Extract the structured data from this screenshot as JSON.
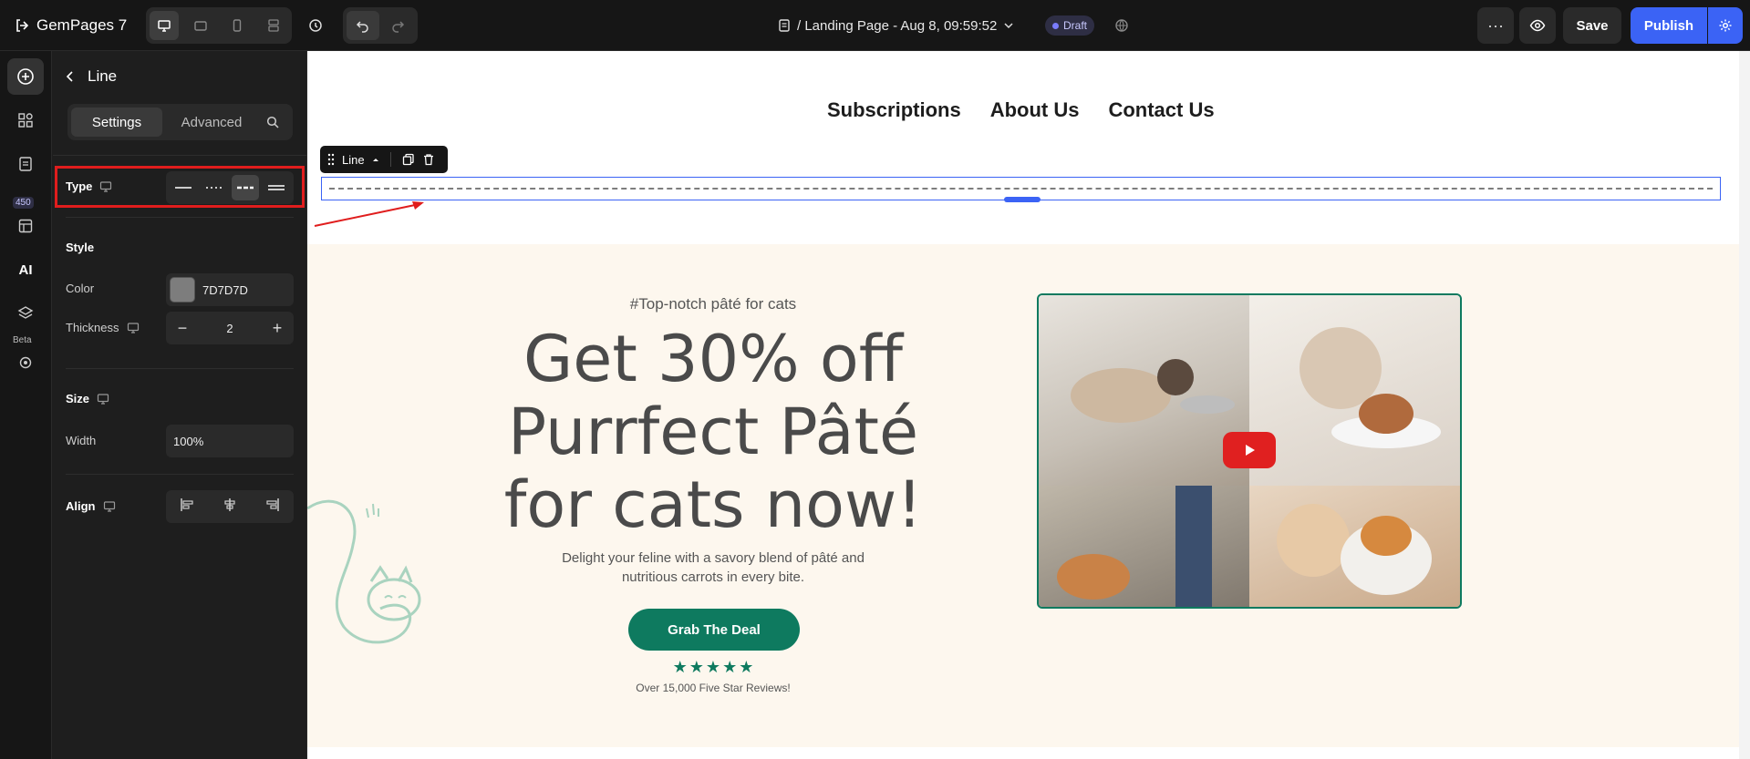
{
  "topbar": {
    "brand": "GemPages 7",
    "page_title": "/ Landing Page - Aug 8, 09:59:52",
    "status_badge": "Draft",
    "save_label": "Save",
    "publish_label": "Publish"
  },
  "rail": {
    "count_badge": "450",
    "ai_label": "AI",
    "beta_label": "Beta"
  },
  "panel": {
    "title": "Line",
    "tabs": [
      "Settings",
      "Advanced"
    ],
    "type_label": "Type",
    "style_label": "Style",
    "color_label": "Color",
    "color_value": "7D7D7D",
    "thickness_label": "Thickness",
    "thickness_value": "2",
    "size_label": "Size",
    "width_label": "Width",
    "width_value": "100%",
    "align_label": "Align",
    "type_options": [
      "solid",
      "dotted",
      "dashed",
      "double"
    ],
    "selected_type": "dashed"
  },
  "canvas": {
    "nav": [
      "Subscriptions",
      "About Us",
      "Contact Us"
    ],
    "line_toolbar_label": "Line",
    "hero": {
      "tag": "#Top-notch pâté for cats",
      "headline": "Get 30% off Purrfect Pâté for cats now!",
      "description": "Delight your feline with a savory blend of pâté and nutritious carrots in every bite.",
      "cta": "Grab The Deal",
      "stars": "★★★★★",
      "reviews": "Over 15,000 Five Star Reviews!"
    }
  },
  "colors": {
    "accent": "#3b63f5",
    "brand_green": "#0e7a5f",
    "line_color": "#7D7D7D",
    "highlight": "#e01d1d",
    "hero_bg": "#fdf7ee"
  }
}
